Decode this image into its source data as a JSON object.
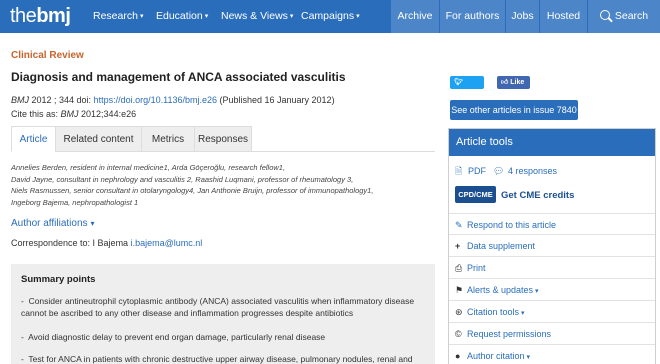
{
  "logo": {
    "the": "the",
    "bmj": "bmj"
  },
  "nav": {
    "left": [
      {
        "label": "Research"
      },
      {
        "label": "Education"
      },
      {
        "label": "News & Views"
      },
      {
        "label": "Campaigns"
      }
    ],
    "right": [
      {
        "label": "Archive"
      },
      {
        "label": "For authors"
      },
      {
        "label": "Jobs"
      },
      {
        "label": "Hosted"
      },
      {
        "label": "Search"
      }
    ],
    "caret": "▾"
  },
  "article": {
    "kicker": "Clinical Review",
    "title": "Diagnosis and management of ANCA associated vasculitis",
    "cite_journal": "BMJ",
    "cite_vol": " 2012 ; 344  doi: ",
    "doi": "https://doi.org/10.1136/bmj.e26",
    "published": " (Published 16 January 2012)",
    "cite_as_label": "Cite this as: ",
    "cite_as_journal": "BMJ",
    "cite_as_ref": "  2012;344:e26"
  },
  "tabs": [
    {
      "label": "Article"
    },
    {
      "label": "Related content"
    },
    {
      "label": "Metrics"
    },
    {
      "label": "Responses"
    }
  ],
  "authors": [
    "Annelies Berden, resident in internal medicine1,  Arda Göçeroğlu, research fellow1,",
    "David Jayne, consultant in nephrology and vasculitis 2,  Raashid Luqmani, professor of rheumatology 3,",
    "Niels Rasmussen, senior consultant in otolaryngology4,  Jan Anthonie Bruijn, professor of immunopathology1,",
    "Ingeborg Bajema, nephropathologist 1"
  ],
  "affiliations_label": "Author affiliations",
  "correspondence": {
    "label": "Correspondence to: I Bajema ",
    "email": "i.bajema@lumc.nl"
  },
  "summary": {
    "heading": "Summary points",
    "points": [
      "Consider antineutrophil cytoplasmic antibody (ANCA) associated vasculitis when inflammatory disease cannot be ascribed to any other disease and inflammation progresses despite antibiotics",
      "Avoid diagnostic delay to prevent end organ damage, particularly renal disease",
      "Test for ANCA in patients with chronic destructive upper airway disease, pulmonary nodules, renal and"
    ]
  },
  "social": {
    "tweet": "Tweet",
    "like": "Like 0"
  },
  "issue_button": "See other articles in issue 7840",
  "tools": {
    "heading": "Article tools",
    "pdf": "PDF",
    "responses": "4 responses",
    "cpd_badge": "CPD/CME",
    "cpd_text": "Get CME credits",
    "items": [
      {
        "label": "Respond to this article",
        "icon": "chat-bubble-icon",
        "chev": ""
      },
      {
        "label": "Data supplement",
        "icon": "plus-icon",
        "chev": ""
      },
      {
        "label": "Print",
        "icon": "print-icon",
        "chev": ""
      },
      {
        "label": "Alerts & updates",
        "icon": "bell-icon",
        "chev": "▾"
      },
      {
        "label": "Citation tools",
        "icon": "citation-icon",
        "chev": "▾"
      },
      {
        "label": "Request permissions",
        "icon": "copyright-icon",
        "chev": ""
      },
      {
        "label": "Author citation",
        "icon": "person-icon",
        "chev": "▾"
      }
    ]
  },
  "colors": {
    "brand": "#2a6ebb",
    "kicker": "#c8642a",
    "cpd": "#1c4f8f"
  }
}
